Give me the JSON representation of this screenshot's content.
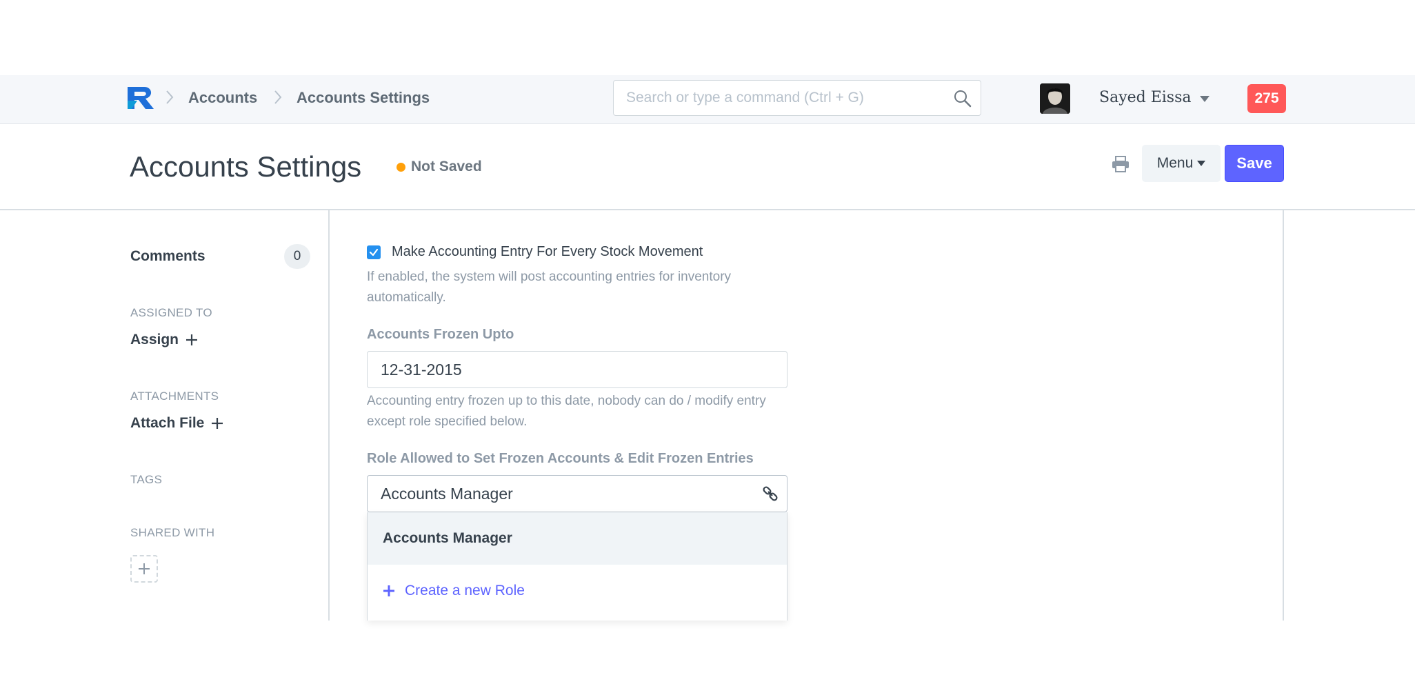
{
  "navbar": {
    "logo_icon": "frappe-logo-icon",
    "breadcrumbs": [
      "Accounts",
      "Accounts Settings"
    ],
    "search_placeholder": "Search or type a command (Ctrl + G)",
    "user_name": "Sayed Eissa",
    "notification_count": "275",
    "notification_color": "#ff5858"
  },
  "page_head": {
    "title": "Accounts Settings",
    "status": "Not Saved",
    "status_color": "#ffa00a",
    "menu_label": "Menu",
    "save_label": "Save",
    "save_color": "#5e64ff"
  },
  "sidebar": {
    "comments_label": "Comments",
    "comments_count": "0",
    "assigned_to_heading": "ASSIGNED TO",
    "assign_label": "Assign",
    "attachments_heading": "ATTACHMENTS",
    "attach_label": "Attach File",
    "tags_heading": "TAGS",
    "shared_with_heading": "SHARED WITH"
  },
  "form": {
    "perpetual_inventory": {
      "label": "Make Accounting Entry For Every Stock Movement",
      "checked": true,
      "help": "If enabled, the system will post accounting entries for inventory automatically."
    },
    "frozen_upto": {
      "label": "Accounts Frozen Upto",
      "value": "12-31-2015",
      "help": "Accounting entry frozen up to this date, nobody can do / modify entry except role specified below."
    },
    "frozen_role": {
      "label": "Role Allowed to Set Frozen Accounts & Edit Frozen Entries",
      "value": "Accounts Manager"
    }
  },
  "dropdown": {
    "items": [
      {
        "label": "Accounts Manager"
      },
      {
        "label": "Create a new Role",
        "icon": "plus-icon"
      }
    ]
  }
}
